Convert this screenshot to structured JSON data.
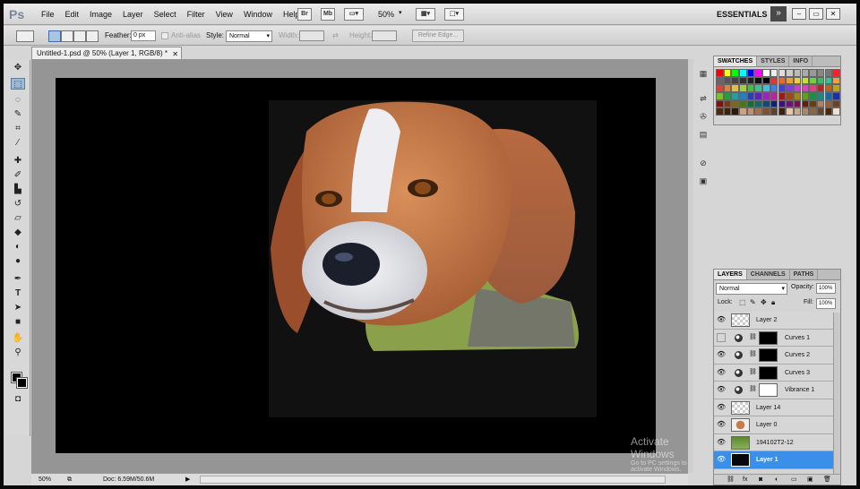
{
  "app": {
    "logo": "Ps",
    "workspace": "ESSENTIALS",
    "zoom": "50%"
  },
  "menu": [
    "File",
    "Edit",
    "Image",
    "Layer",
    "Select",
    "Filter",
    "View",
    "Window",
    "Help"
  ],
  "menubar_buttons": {
    "bridge": "Br",
    "minibridge": "Mb"
  },
  "options": {
    "feather_label": "Feather:",
    "feather_value": "0 px",
    "antialias_label": "Anti-alias",
    "style_label": "Style:",
    "style_value": "Normal",
    "width_label": "Width:",
    "height_label": "Height:",
    "refine_edge": "Refine Edge..."
  },
  "document": {
    "tab_title": "Untitled-1.psd @ 50% (Layer 1, RGB/8) *",
    "zoom": "50%",
    "doc_info": "Doc: 6.59M/50.6M"
  },
  "panels": {
    "swatches_tabs": [
      "SWATCHES",
      "STYLES",
      "INFO"
    ],
    "layers_tabs": [
      "LAYERS",
      "CHANNELS",
      "PATHS"
    ],
    "blend_mode": "Normal",
    "opacity_label": "Opacity:",
    "opacity_value": "100%",
    "lock_label": "Lock:",
    "fill_label": "Fill:",
    "fill_value": "100%"
  },
  "layers": [
    {
      "name": "Layer 2",
      "visible": true,
      "type": "pixel",
      "selected": false
    },
    {
      "name": "Curves 1",
      "visible": false,
      "type": "adjustment",
      "selected": false
    },
    {
      "name": "Curves 2",
      "visible": true,
      "type": "adjustment",
      "selected": false
    },
    {
      "name": "Curves 3",
      "visible": true,
      "type": "adjustment",
      "selected": false
    },
    {
      "name": "Vibrance 1",
      "visible": true,
      "type": "adjustment",
      "selected": false
    },
    {
      "name": "Layer 14",
      "visible": true,
      "type": "pixel",
      "selected": false
    },
    {
      "name": "Layer 0",
      "visible": true,
      "type": "photo",
      "selected": false
    },
    {
      "name": "194102T2-12",
      "visible": true,
      "type": "photo-green",
      "selected": false
    },
    {
      "name": "Layer 1",
      "visible": true,
      "type": "dark",
      "selected": true
    }
  ],
  "watermark": {
    "title": "Activate Windows",
    "subtitle": "Go to PC settings to activate Windows."
  },
  "colors": {
    "accent": "#3b8fe8",
    "canvas": "#000000",
    "workspace": "#959595"
  },
  "icons": [
    "move-icon",
    "marquee-icon",
    "lasso-icon",
    "quick-select-icon",
    "crop-icon",
    "eyedropper-icon",
    "healing-icon",
    "brush-icon",
    "stamp-icon",
    "history-brush-icon",
    "eraser-icon",
    "bucket-icon",
    "blur-icon",
    "dodge-icon",
    "pen-icon",
    "type-icon",
    "path-select-icon",
    "shape-icon",
    "hand-icon",
    "zoom-icon"
  ]
}
